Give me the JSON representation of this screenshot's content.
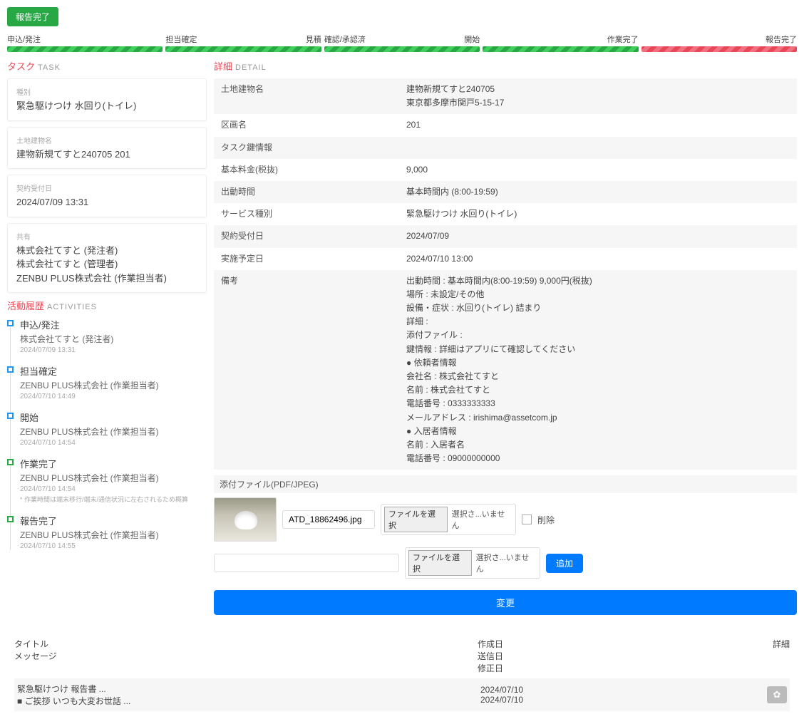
{
  "status_badge": "報告完了",
  "progress": [
    {
      "left": "申込/発注",
      "right": "",
      "color": "green"
    },
    {
      "left": "担当確定",
      "right": "見積",
      "color": "green"
    },
    {
      "left": "確認/承認済",
      "right": "開始",
      "color": "green"
    },
    {
      "left": "",
      "right": "作業完了",
      "color": "green"
    },
    {
      "left": "",
      "right": "報告完了",
      "color": "red"
    }
  ],
  "task_section": {
    "title_jp": "タスク",
    "title_en": "TASK"
  },
  "task_cards": [
    {
      "label": "種別",
      "value": "緊急駆けつけ 水回り(トイレ)"
    },
    {
      "label": "土地建物名",
      "value": "建物新規てすと240705 201"
    },
    {
      "label": "契約受付日",
      "value": "2024/07/09 13:31"
    },
    {
      "label": "共有",
      "value": "株式会社てすと (発注者)\n株式会社てすと (管理者)\nZENBU PLUS株式会社 (作業担当者)"
    }
  ],
  "activities_section": {
    "title_jp": "活動履歴",
    "title_en": "ACTIVITIES"
  },
  "activities": [
    {
      "title": "申込/発注",
      "sub": "株式会社てすと (発注者)",
      "time": "2024/07/09 13:31",
      "done": false
    },
    {
      "title": "担当確定",
      "sub": "ZENBU PLUS株式会社 (作業担当者)",
      "time": "2024/07/10 14:49",
      "done": false
    },
    {
      "title": "開始",
      "sub": "ZENBU PLUS株式会社 (作業担当者)",
      "time": "2024/07/10 14:54",
      "done": false
    },
    {
      "title": "作業完了",
      "sub": "ZENBU PLUS株式会社 (作業担当者)",
      "time": "2024/07/10 14:54",
      "note": "* 作業時間は端末移行/端末/通信状況に左右されるため概算",
      "done": true
    },
    {
      "title": "報告完了",
      "sub": "ZENBU PLUS株式会社 (作業担当者)",
      "time": "2024/07/10 14:55",
      "done": true
    }
  ],
  "detail_section": {
    "title_jp": "詳細",
    "title_en": "DETAIL"
  },
  "details": [
    {
      "k": "土地建物名",
      "v": "建物新規てすと240705\n東京都多摩市関戸5-15-17"
    },
    {
      "k": "区画名",
      "v": "201"
    },
    {
      "k": "タスク鍵情報",
      "v": ""
    },
    {
      "k": "基本料金(税抜)",
      "v": "9,000"
    },
    {
      "k": "出動時間",
      "v": "基本時間内 (8:00-19:59)"
    },
    {
      "k": "サービス種別",
      "v": "緊急駆けつけ 水回り(トイレ)"
    },
    {
      "k": "契約受付日",
      "v": "2024/07/09"
    },
    {
      "k": "実施予定日",
      "v": "2024/07/10 13:00"
    },
    {
      "k": "備考",
      "v": "出動時間 : 基本時間内(8:00-19:59) 9,000円(税抜)\n場所 : 未設定/その他\n設備・症状 : 水回り(トイレ) 詰まり\n詳細 :\n添付ファイル :\n鍵情報 : 詳細はアプリにて確認してください\n● 依頼者情報\n会社名 : 株式会社てすと\n名前 : 株式会社てすと\n電話番号 : 0333333333\nメールアドレス : irishima@assetcom.jp\n● 入居者情報\n名前 : 入居者名\n電話番号 : 09000000000"
    }
  ],
  "attach_header": "添付ファイル(PDF/JPEG)",
  "attach1_filename": "ATD_18862496.jpg",
  "file_choose_label": "ファイルを選択",
  "file_none_label": "選択さ...いません",
  "delete_label": "削除",
  "add_button": "追加",
  "submit_button": "変更",
  "messages": {
    "col1_a": "タイトル",
    "col1_b": "メッセージ",
    "col2_a": "作成日",
    "col2_b": "送信日",
    "col2_c": "修正日",
    "col3": "詳細",
    "row_title": "緊急駆けつけ 報告書 ...",
    "row_msg": "■ ご挨拶 いつも大変お世話 ...",
    "row_date1": "2024/07/10",
    "row_date2": "2024/07/10"
  }
}
